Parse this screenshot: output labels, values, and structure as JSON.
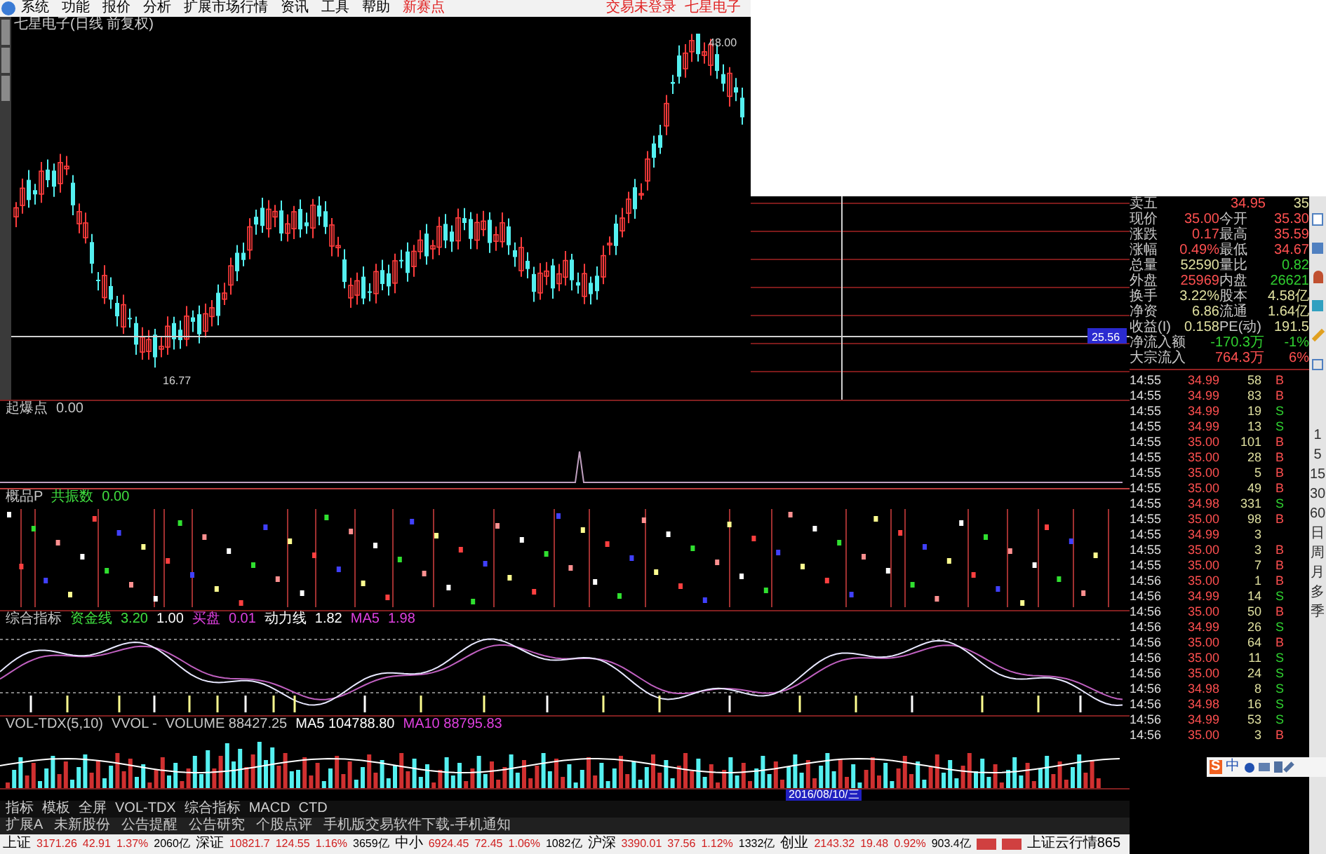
{
  "menu": {
    "items": [
      {
        "text": "系统",
        "kind": "item"
      },
      {
        "text": "功能",
        "kind": "item"
      },
      {
        "text": "报价",
        "kind": "item"
      },
      {
        "text": "分析",
        "kind": "item"
      },
      {
        "text": "扩展市场行情",
        "kind": "item"
      },
      {
        "text": "资讯",
        "kind": "item"
      },
      {
        "text": "工具",
        "kind": "item"
      },
      {
        "text": "帮助",
        "kind": "item"
      },
      {
        "text": "新赛点",
        "kind": "promo"
      }
    ],
    "account": [
      "交易未登录",
      "七星电子"
    ]
  },
  "price_chart": {
    "title": "七星电子(日线 前复权)",
    "high_label": "48.00",
    "low_label": "16.77",
    "price_tag": "25.56"
  },
  "panels": [
    {
      "kind": "signal",
      "legend": [
        {
          "text": "起爆点",
          "color": "#c8c8c8"
        },
        {
          "text": "0.00",
          "color": "#c8c8c8"
        }
      ]
    },
    {
      "kind": "dots",
      "legend": [
        {
          "text": "概品P",
          "color": "#c8c8c8"
        },
        {
          "text": "共振数",
          "color": "#40e040"
        },
        {
          "text": "0.00",
          "color": "#40e040"
        }
      ]
    },
    {
      "kind": "lines",
      "legend": [
        {
          "text": "综合指标",
          "color": "#c8c8c8"
        },
        {
          "text": "资金线",
          "color": "#40e040"
        },
        {
          "text": "3.20",
          "color": "#40e040"
        },
        {
          "text": "1.00",
          "color": "#ffffff"
        },
        {
          "text": "买盘",
          "color": "#e040e0"
        },
        {
          "text": "0.01",
          "color": "#e040e0"
        },
        {
          "text": "动力线",
          "color": "#ffffff"
        },
        {
          "text": "1.82",
          "color": "#ffffff"
        },
        {
          "text": "MA5",
          "color": "#e040e0"
        },
        {
          "text": "1.98",
          "color": "#e040e0"
        }
      ]
    },
    {
      "kind": "volume",
      "legend": [
        {
          "text": "VOL-TDX(5,10)",
          "color": "#c8c8c8"
        },
        {
          "text": "VVOL -",
          "color": "#c8c8c8"
        },
        {
          "text": "VOLUME 88427.25",
          "color": "#c8c8c8"
        },
        {
          "text": "MA5 104788.80",
          "color": "#ffffff"
        },
        {
          "text": "MA10 88795.83",
          "color": "#e040e0"
        }
      ]
    }
  ],
  "date_label": "2016/08/10/三",
  "bottom_tabs": [
    "指标",
    "模板",
    "全屏",
    "VOL-TDX",
    "综合指标",
    "MACD",
    "CTD"
  ],
  "info_links": [
    "扩展A",
    "未新股份",
    "公告提醒",
    "公告研究",
    "个股点评",
    "手机版交易软件下载-手机通知"
  ],
  "status_bar": {
    "markets": [
      {
        "name": "上证",
        "index": "3171.26",
        "change": "42.91",
        "pct": "1.37%",
        "amount": "2060亿"
      },
      {
        "name": "深证",
        "index": "10821.7",
        "change": "124.55",
        "pct": "1.16%",
        "amount": "3659亿"
      },
      {
        "name": "中小",
        "index": "6924.45",
        "change": "72.45",
        "pct": "1.06%",
        "amount": "1082亿"
      },
      {
        "name": "沪深",
        "index": "3390.01",
        "change": "37.56",
        "pct": "1.12%",
        "amount": "1332亿"
      },
      {
        "name": "创业",
        "index": "2143.32",
        "change": "19.48",
        "pct": "0.92%",
        "amount": "903.4亿"
      }
    ],
    "server": "上证云行情865"
  },
  "quote": [
    {
      "kind": "order",
      "cells": [
        {
          "text": "卖五",
          "kind": "label"
        },
        {
          "text": "34.95",
          "kind": "up"
        },
        {
          "text": "35",
          "kind": "volume"
        }
      ]
    },
    {
      "kind": "pair",
      "cells": [
        {
          "text": "现价",
          "kind": "label"
        },
        {
          "text": "35.00",
          "kind": "up"
        },
        {
          "text": "今开",
          "kind": "label"
        },
        {
          "text": "35.30",
          "kind": "up"
        }
      ]
    },
    {
      "kind": "pair",
      "cells": [
        {
          "text": "涨跌",
          "kind": "label"
        },
        {
          "text": "0.17",
          "kind": "up"
        },
        {
          "text": "最高",
          "kind": "label"
        },
        {
          "text": "35.59",
          "kind": "up"
        }
      ]
    },
    {
      "kind": "pair",
      "cells": [
        {
          "text": "涨幅",
          "kind": "label"
        },
        {
          "text": "0.49%",
          "kind": "up"
        },
        {
          "text": "最低",
          "kind": "label"
        },
        {
          "text": "34.67",
          "kind": "up"
        }
      ]
    },
    {
      "kind": "pair",
      "cells": [
        {
          "text": "总量",
          "kind": "label"
        },
        {
          "text": "52590",
          "kind": "volume"
        },
        {
          "text": "量比",
          "kind": "label"
        },
        {
          "text": "0.82",
          "kind": "down"
        }
      ]
    },
    {
      "kind": "pair",
      "cells": [
        {
          "text": "外盘",
          "kind": "label"
        },
        {
          "text": "25969",
          "kind": "up"
        },
        {
          "text": "内盘",
          "kind": "label"
        },
        {
          "text": "26621",
          "kind": "down"
        }
      ]
    },
    {
      "kind": "pair",
      "cells": [
        {
          "text": "换手",
          "kind": "label"
        },
        {
          "text": "3.22%",
          "kind": "volume"
        },
        {
          "text": "股本",
          "kind": "label"
        },
        {
          "text": "4.58亿",
          "kind": "volume"
        }
      ]
    },
    {
      "kind": "pair",
      "cells": [
        {
          "text": "净资",
          "kind": "label"
        },
        {
          "text": "6.86",
          "kind": "volume"
        },
        {
          "text": "流通",
          "kind": "label"
        },
        {
          "text": "1.64亿",
          "kind": "volume"
        }
      ]
    },
    {
      "kind": "pair",
      "cells": [
        {
          "text": "收益(I)",
          "kind": "label"
        },
        {
          "text": "0.158",
          "kind": "volume"
        },
        {
          "text": "PE(动)",
          "kind": "label"
        },
        {
          "text": "191.5",
          "kind": "volume"
        }
      ]
    },
    {
      "kind": "flow",
      "cells": [
        {
          "text": "净流入额",
          "kind": "label"
        },
        {
          "text": "-170.3万",
          "kind": "down"
        },
        {
          "text": "-1%",
          "kind": "down"
        }
      ]
    },
    {
      "kind": "flow",
      "cells": [
        {
          "text": "大宗流入",
          "kind": "label"
        },
        {
          "text": "764.3万",
          "kind": "up"
        },
        {
          "text": "6%",
          "kind": "up"
        }
      ]
    }
  ],
  "ticks": [
    {
      "time": "14:55",
      "price": "34.99",
      "volume": "58",
      "side": "B",
      "kind": "buy"
    },
    {
      "time": "14:55",
      "price": "34.99",
      "volume": "83",
      "side": "B",
      "kind": "buy"
    },
    {
      "time": "14:55",
      "price": "34.99",
      "volume": "19",
      "side": "S",
      "kind": "sell"
    },
    {
      "time": "14:55",
      "price": "34.99",
      "volume": "13",
      "side": "S",
      "kind": "sell"
    },
    {
      "time": "14:55",
      "price": "35.00",
      "volume": "101",
      "side": "B",
      "kind": "buy"
    },
    {
      "time": "14:55",
      "price": "35.00",
      "volume": "28",
      "side": "B",
      "kind": "buy"
    },
    {
      "time": "14:55",
      "price": "35.00",
      "volume": "5",
      "side": "B",
      "kind": "buy"
    },
    {
      "time": "14:55",
      "price": "35.00",
      "volume": "49",
      "side": "B",
      "kind": "buy"
    },
    {
      "time": "14:55",
      "price": "34.98",
      "volume": "331",
      "side": "S",
      "kind": "sell"
    },
    {
      "time": "14:55",
      "price": "35.00",
      "volume": "98",
      "side": "B",
      "kind": "buy"
    },
    {
      "time": "14:55",
      "price": "34.99",
      "volume": "3",
      "kind": "none"
    },
    {
      "time": "14:55",
      "price": "35.00",
      "volume": "3",
      "side": "B",
      "kind": "buy"
    },
    {
      "time": "14:55",
      "price": "35.00",
      "volume": "7",
      "side": "B",
      "kind": "buy"
    },
    {
      "time": "14:56",
      "price": "35.00",
      "volume": "1",
      "side": "B",
      "kind": "buy"
    },
    {
      "time": "14:56",
      "price": "34.99",
      "volume": "14",
      "side": "S",
      "kind": "sell"
    },
    {
      "time": "14:56",
      "price": "35.00",
      "volume": "50",
      "side": "B",
      "kind": "buy"
    },
    {
      "time": "14:56",
      "price": "34.99",
      "volume": "26",
      "side": "S",
      "kind": "sell"
    },
    {
      "time": "14:56",
      "price": "35.00",
      "volume": "64",
      "side": "B",
      "kind": "buy"
    },
    {
      "time": "14:56",
      "price": "35.00",
      "volume": "11",
      "side": "S",
      "kind": "sell"
    },
    {
      "time": "14:56",
      "price": "35.00",
      "volume": "24",
      "side": "S",
      "kind": "sell"
    },
    {
      "time": "14:56",
      "price": "34.98",
      "volume": "8",
      "side": "S",
      "kind": "sell"
    },
    {
      "time": "14:56",
      "price": "34.98",
      "volume": "16",
      "side": "S",
      "kind": "sell"
    },
    {
      "time": "14:56",
      "price": "34.99",
      "volume": "53",
      "side": "S",
      "kind": "sell"
    },
    {
      "time": "14:56",
      "price": "35.00",
      "volume": "3",
      "side": "B",
      "kind": "buy"
    }
  ],
  "periods": [
    "1",
    "5",
    "15",
    "30",
    "60",
    "日",
    "周",
    "月",
    "多",
    "季"
  ],
  "ime_bar": {
    "logo": "S",
    "mode": "中"
  }
}
